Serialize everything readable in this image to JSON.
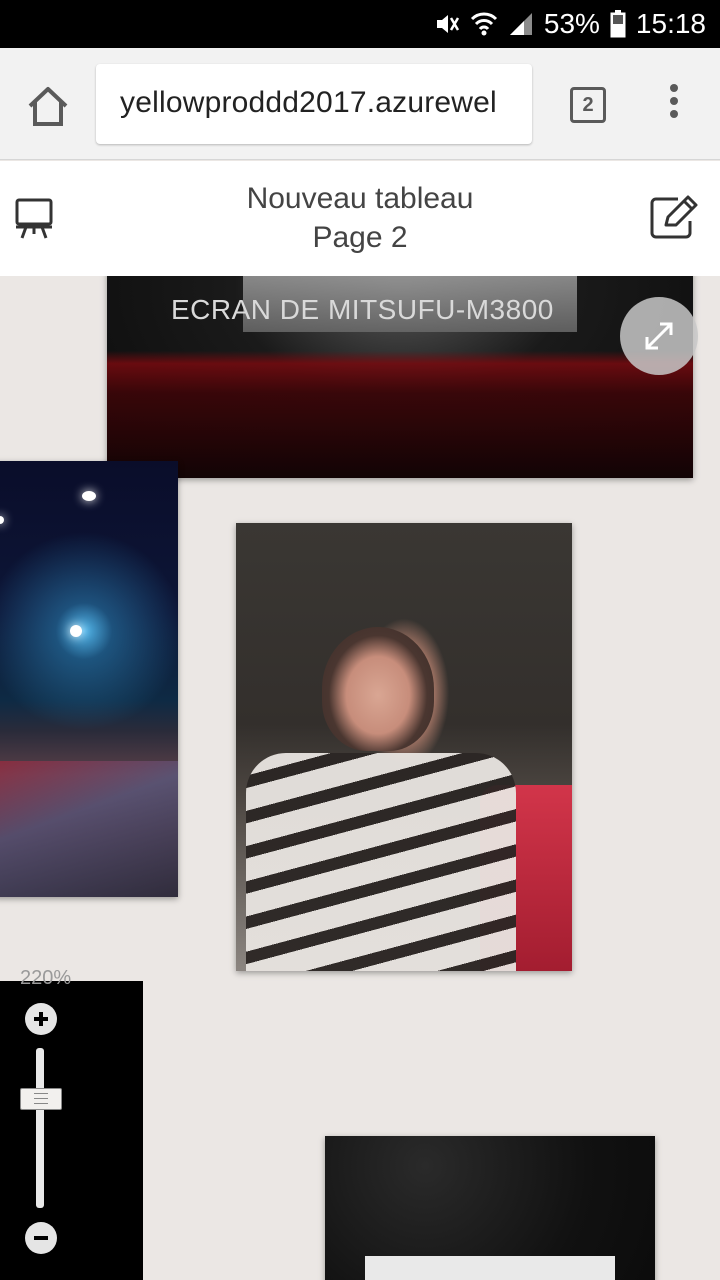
{
  "status_bar": {
    "icons": [
      "mute-icon",
      "wifi-icon",
      "signal-icon",
      "battery-icon"
    ],
    "battery": "53%",
    "time": "15:18"
  },
  "browser": {
    "url": "yellowproddd2017.azurewel",
    "tab_count": "2"
  },
  "app_header": {
    "title": "Nouveau tableau",
    "subtitle": "Page 2"
  },
  "canvas": {
    "photo_top_caption": "ECRAN DE MITSUFU-M3800"
  },
  "zoom": {
    "level": "220%",
    "level_value": 220
  },
  "colors": {
    "canvas_bg": "#ebe7e4",
    "toolbar_bg": "#f2f2f2",
    "header_bg": "#ffffff"
  }
}
